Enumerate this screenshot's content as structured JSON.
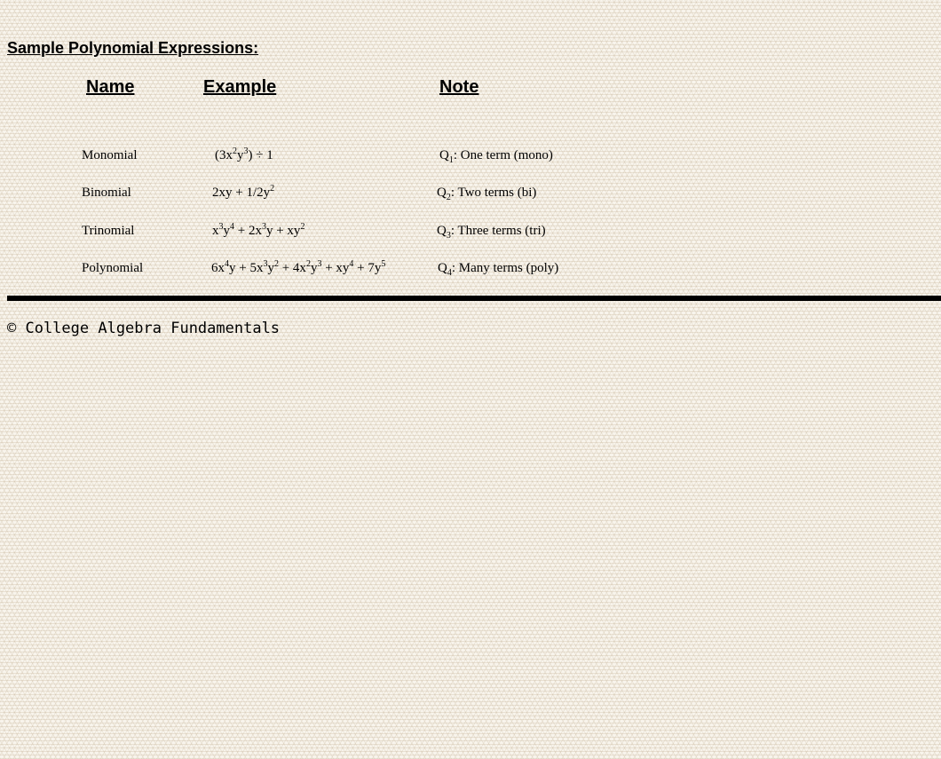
{
  "heading": "Sample Polynomial Expressions:",
  "columns": {
    "name": "Name",
    "example": "Example",
    "note": "Note"
  },
  "rows": [
    {
      "name": "Monomial",
      "example": [
        {
          "t": "(3x"
        },
        {
          "sup": "2"
        },
        {
          "t": "y"
        },
        {
          "sup": "3"
        },
        {
          "t": ") ÷ 1"
        }
      ],
      "note": [
        {
          "t": "Q"
        },
        {
          "sub": "1"
        },
        {
          "t": ": One term (mono)"
        }
      ]
    },
    {
      "name": "Binomial",
      "example": [
        {
          "t": "2xy + 1/2y"
        },
        {
          "sup": "2"
        }
      ],
      "note": [
        {
          "t": "Q"
        },
        {
          "sub": "2"
        },
        {
          "t": ": Two terms (bi)"
        }
      ]
    },
    {
      "name": "Trinomial",
      "example": [
        {
          "t": "x"
        },
        {
          "sup": "3"
        },
        {
          "t": "y"
        },
        {
          "sup": "4"
        },
        {
          "t": " + 2x"
        },
        {
          "sup": "3"
        },
        {
          "t": "y + xy"
        },
        {
          "sup": "2"
        }
      ],
      "note": [
        {
          "t": "Q"
        },
        {
          "sub": "3"
        },
        {
          "t": ": Three terms (tri)"
        }
      ]
    },
    {
      "name": "Polynomial",
      "example": [
        {
          "t": "6x"
        },
        {
          "sup": "4"
        },
        {
          "t": "y + 5x"
        },
        {
          "sup": "3"
        },
        {
          "t": "y"
        },
        {
          "sup": "2"
        },
        {
          "t": " + 4x"
        },
        {
          "sup": "2"
        },
        {
          "t": "y"
        },
        {
          "sup": "3"
        },
        {
          "t": " + xy"
        },
        {
          "sup": "4"
        },
        {
          "t": " + 7y"
        },
        {
          "sup": "5"
        }
      ],
      "note": [
        {
          "t": "Q"
        },
        {
          "sub": "4"
        },
        {
          "t": ": Many terms (poly)"
        }
      ]
    }
  ],
  "footer": "© College Algebra Fundamentals"
}
